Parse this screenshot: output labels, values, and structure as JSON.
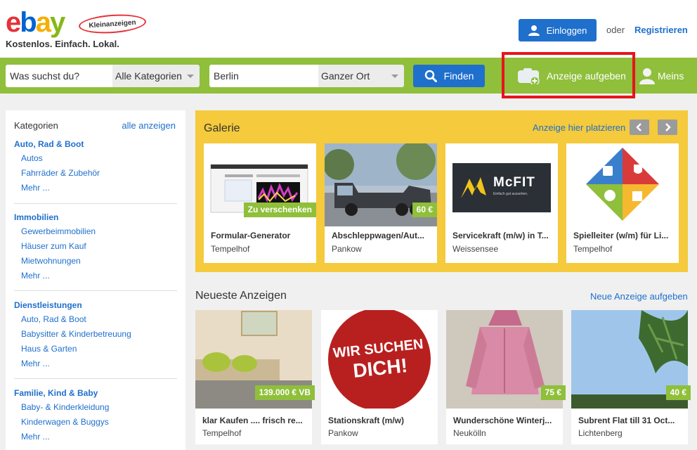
{
  "header": {
    "logo_letters": [
      "e",
      "b",
      "a",
      "y"
    ],
    "logo_colors": [
      "#e53238",
      "#0064d2",
      "#f5af02",
      "#86b817"
    ],
    "badge": "Kleinanzeigen",
    "tagline": "Kostenlos. Einfach. Lokal.",
    "login_label": "Einloggen",
    "or_text": "oder",
    "register_label": "Registrieren"
  },
  "search": {
    "query_placeholder": "Was suchst du?",
    "category_selected": "Alle Kategorien",
    "location_value": "Berlin",
    "radius_selected": "Ganzer Ort",
    "find_label": "Finden",
    "post_ad_label": "Anzeige aufgeben",
    "my_label": "Meins"
  },
  "sidebar": {
    "heading": "Kategorien",
    "show_all": "alle anzeigen",
    "groups": [
      {
        "title": "Auto, Rad & Boot",
        "items": [
          "Autos",
          "Fahrräder & Zubehör",
          "Mehr ..."
        ]
      },
      {
        "title": "Immobilien",
        "items": [
          "Gewerbeimmobilien",
          "Häuser zum Kauf",
          "Mietwohnungen",
          "Mehr ..."
        ]
      },
      {
        "title": "Dienstleistungen",
        "items": [
          "Auto, Rad & Boot",
          "Babysitter & Kinderbetreuung",
          "Haus & Garten",
          "Mehr ..."
        ]
      },
      {
        "title": "Familie, Kind & Baby",
        "items": [
          "Baby- & Kinderkleidung",
          "Kinderwagen & Buggys",
          "Mehr ..."
        ]
      }
    ]
  },
  "gallery": {
    "title": "Galerie",
    "place_here": "Anzeige hier platzieren",
    "cards": [
      {
        "name": "Formular-Generator",
        "location": "Tempelhof",
        "price": "Zu verschenken"
      },
      {
        "name": "Abschleppwagen/Aut...",
        "location": "Pankow",
        "price": "60 €"
      },
      {
        "name": "Servicekraft (m/w) in T...",
        "location": "Weissensee",
        "price": ""
      },
      {
        "name": "Spielleiter (w/m) für Li...",
        "location": "Tempelhof",
        "price": ""
      }
    ],
    "mcfit_logo": "McFIT",
    "mcfit_slogan": "Einfach gut aussehen."
  },
  "newest": {
    "title": "Neueste Anzeigen",
    "new_ad_link": "Neue Anzeige aufgeben",
    "cards": [
      {
        "name": "klar Kaufen .... frisch re...",
        "location": "Tempelhof",
        "price": "139.000 € VB"
      },
      {
        "name": "Stationskraft (m/w)",
        "location": "Pankow",
        "price": ""
      },
      {
        "name": "Wunderschöne Winterj...",
        "location": "Neukölln",
        "price": "75 €"
      },
      {
        "name": "Subrent Flat till 31 Oct...",
        "location": "Lichtenberg",
        "price": "40 €"
      }
    ],
    "sticker_line1": "WIR SUCHEN",
    "sticker_line2": "DICH!"
  }
}
